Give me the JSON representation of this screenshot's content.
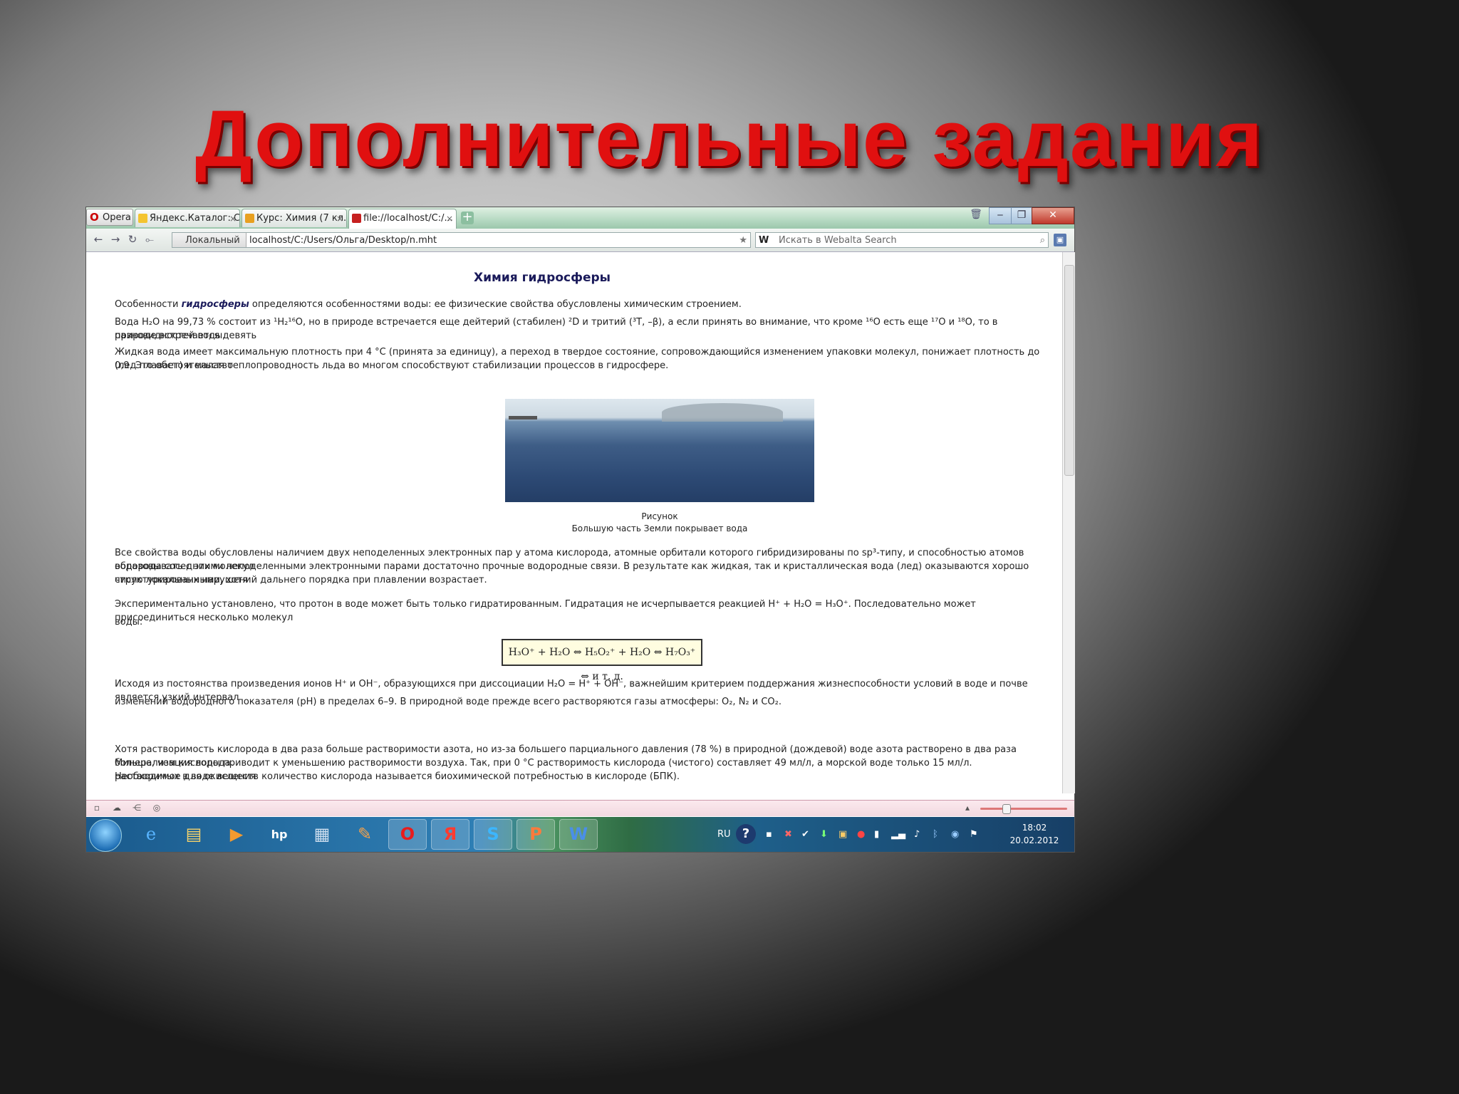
{
  "slide": {
    "title": "Дополнительные задания"
  },
  "browser": {
    "menu_label": "Opera",
    "tabs": [
      {
        "label": "Яндекс.Каталог: С..."
      },
      {
        "label": "Курс: Химия (7 кл..."
      },
      {
        "label": "file://localhost/C:/..."
      }
    ],
    "new_tab": "+",
    "window_controls": {
      "minimize": "‒",
      "maximize": "❐",
      "close": "✕"
    },
    "nav": {
      "back": "←",
      "forward": "→",
      "reload": "↻",
      "home": "⟜"
    },
    "address": {
      "badge": "Локальный",
      "url": "localhost/C:/Users/Ольга/Desktop/n.mht",
      "star": "★"
    },
    "search": {
      "engine": "W",
      "placeholder": "Искать в Webalta Search",
      "icon": "⌕"
    }
  },
  "page": {
    "heading": "Химия гидросферы",
    "p1_a": "Особенности ",
    "p1_em": "гидросферы",
    "p1_b": " определяются особенностями воды: ее физические свойства обусловлены химическим строением.",
    "p2_line1": "Вода H₂O на 99,73 % состоит из ¹H₂¹⁶O, но в природе встречается еще дейтерий (стабилен) ²D и тритий (³T, –β), а если принять во внимание, что кроме ¹⁶O есть еще ¹⁷O и ¹⁸O, то в природе встречается девять",
    "p2_line2": "разновидностей воды.",
    "p3_line1": "Жидкая вода имеет максимальную плотность при 4 °C (принята за единицу), а переход в твердое состояние, сопровождающийся изменением упаковки молекул, понижает плотность до 0,9. Это обстоятельство",
    "p3_line2": "(лед плавает) и малая теплопроводность льда во многом способствуют стабилизации процессов в гидросфере.",
    "figure_caption_1": "Рисунок",
    "figure_caption_2": "Большую часть Земли покрывает вода",
    "p4_line1": "Все свойства воды обусловлены наличием двух неподеленных электронных пар у атома кислорода, атомные орбитали которого гибридизированы по sp³-типу, и способностью атомов водорода соседних молекул",
    "p4_line2": "образовывать с этими неподеленными электронными парами достаточно прочные водородные связи. В результате как жидкая, так и кристаллическая вода (лед) оказываются хорошо структурированными, хотя",
    "p4_line3": "число локальных нарушений дальнего порядка при плавлении возрастает.",
    "p5_line1": "Экспериментально установлено, что протон в воде может быть только гидратированным. Гидратация не исчерпывается реакцией H⁺ + H₂O = H₃O⁺. Последовательно может присоединиться несколько молекул",
    "p5_line2": "воды:",
    "formula": "H₃O⁺ + H₂O ⇔ H₅O₂⁺ + H₂O ⇔ H₇O₃⁺ ⇔ и т. д.",
    "p6_line1": "Исходя из постоянства произведения ионов H⁺ и OH⁻, образующихся при диссоциации H₂O = H⁺ + OH⁻, важнейшим критерием поддержания жизнеспособности условий в воде и почве является узкий интервал",
    "p6_line2": "изменений водородного показателя (pH) в пределах 6–9. В природной воде прежде всего растворяются газы атмосферы: O₂, N₂  и CO₂.",
    "p7_line1": "Хотя растворимость кислорода в два раза больше растворимости азота, но из-за большего парциального давления (78 %) в природной (дождевой) воде азота растворено в два раза больше, чем кислорода.",
    "p7_line2": "Минерализация воды приводит к уменьшению растворимости воздуха. Так, при 0 °C растворимость кислорода (чистого) составляет 49 мл/л, а морской воде только 15 мл/л. Необходимое для окисления",
    "p7_line3": "растворимых в воде веществ количество кислорода называется биохимической потребностью в кислороде (БПК)."
  },
  "taskbar": {
    "apps": [
      {
        "name": "internet-explorer",
        "glyph": "e"
      },
      {
        "name": "file-explorer",
        "glyph": "▤"
      },
      {
        "name": "media-player",
        "glyph": "▶"
      },
      {
        "name": "hp",
        "glyph": "hp"
      },
      {
        "name": "network-computer",
        "glyph": "▦"
      },
      {
        "name": "paint-tool",
        "glyph": "✎"
      },
      {
        "name": "opera",
        "glyph": "O"
      },
      {
        "name": "yandex",
        "glyph": "Я"
      },
      {
        "name": "skype",
        "glyph": "S"
      },
      {
        "name": "powerpoint",
        "glyph": "P"
      },
      {
        "name": "word",
        "glyph": "W"
      }
    ],
    "lang": "RU",
    "help": "?",
    "time": "18:02",
    "date": "20.02.2012"
  },
  "colors": {
    "title_red": "#e01010",
    "taskbar_blue": "#1a5a8c"
  }
}
